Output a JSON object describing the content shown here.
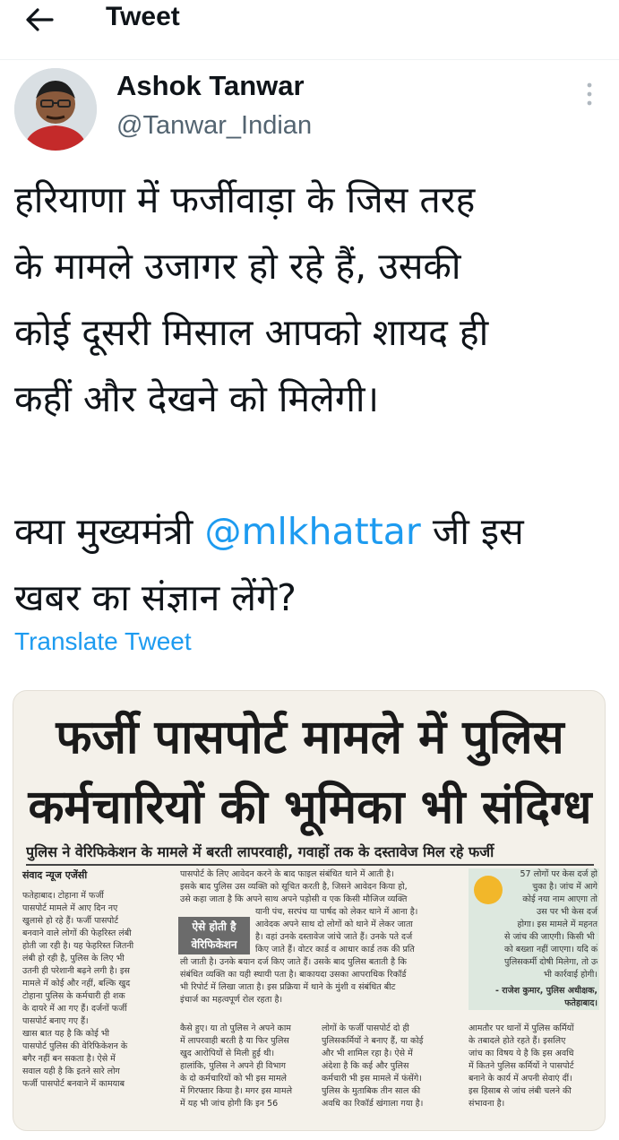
{
  "header": {
    "title": "Tweet"
  },
  "author": {
    "name": "Ashok Tanwar",
    "handle": "@Tanwar_Indian"
  },
  "tweet": {
    "lines": [
      "हरियाणा में फर्जीवाड़ा के जिस तरह",
      "के मामले उजागर हो रहे हैं, उसकी",
      "कोई दूसरी मिसाल आपको शायद ही",
      "कहीं और देखने को मिलेगी।"
    ],
    "line5_prefix": "क्या मुख्यमंत्री ",
    "mention": "@mlkhattar",
    "line5_suffix": " जी इस",
    "line6": "खबर का संज्ञान लेंगे?",
    "translate_label": "Translate Tweet"
  },
  "news_clipping": {
    "headline_line1": "फर्जी पासपोर्ट मामले में पुलिस",
    "headline_line2": "कर्मचारियों की भूमिका भी संदिग्ध",
    "subheadline": "पुलिस ने वेरिफिकेशन के मामले में बरती लापरवाही, गवाहों तक के दस्तावेज मिल रहे फर्जी",
    "source": "संवाद न्यूज एजेंसी",
    "box_line1": "ऐसे होती है",
    "box_line2": "वेरिफिकेशन",
    "quote_attribution": "- राजेश कुमार, पुलिस अधीक्षक, फतेहाबाद।",
    "col1": [
      "फतेहाबाद। टोहाना में फर्जी",
      "पासपोर्ट मामले में आए दिन नए",
      "खुलासे हो रहे हैं। फर्जी पासपोर्ट",
      "बनवाने वाले लोगों की फेहरिस्त लंबी",
      "होती जा रही है। यह फेहरिस्त जितनी",
      "लंबी हो रही है, पुलिस के लिए भी",
      "उतनी ही परेशानी बढ़ने लगी है। इस",
      "मामले में कोई और नहीं, बल्कि खुद",
      "टोहाना पुलिस के कर्मचारी ही शक",
      "के दायरे में आ गए हैं। दर्जनों फर्जी",
      "पासपोर्ट बनाए गए हैं।",
      "खास बात यह है कि कोई भी",
      "पासपोर्ट पुलिस की वेरिफिकेशन के",
      "बगैर नहीं बन सकता है। ऐसे में",
      "सवाल यही है कि इतने सारे लोग",
      "फर्जी पासपोर्ट बनवाने में कामयाब"
    ],
    "col2": [
      "पासपोर्ट के लिए आवेदन करने के बाद फाइल संबंधित थाने में आती है।",
      "इसके बाद पुलिस उस व्यक्ति को सूचित करती है, जिसने आवेदन किया हो,",
      "उसे कहा जाता है कि अपने साथ अपने पड़ोसी व एक किसी मौजिज व्यक्ति",
      "यानी पंच, सरपंच या पार्षद को लेकर थाने में आना है।",
      "आवेदक अपने साथ दो लोगों को थाने में लेकर जाता",
      "है। वहां उनके दस्तावेज जांचे जाते हैं। उनके पते दर्ज",
      "किए जाते हैं। वोटर कार्ड व आधार कार्ड तक की प्रति",
      "ली जाती है। उनके बयान दर्ज किए जाते हैं। उसके बाद पुलिस बताती है कि",
      "संबंधित व्यक्ति का यही स्थायी पता है। बाकायदा उसका आपराधिक रिकॉर्ड",
      "भी रिपोर्ट में लिखा जाता है। इस प्रक्रिया में थाने के मुंशी व संबंधित बीट",
      "इंचार्ज का महत्वपूर्ण रोल रहता है।",
      "कैसे हुए। या तो पुलिस ने अपने काम",
      "में लापरवाही बरती है या फिर पुलिस",
      "खुद आरोपियों से मिली हुई थी।",
      "हालांकि, पुलिस ने अपने ही विभाग",
      "के दो कर्मचारियों को भी इस मामले",
      "में गिरफ्तार किया है। मगर इस मामले",
      "में यह भी जांच होगी कि इन 56"
    ],
    "col3": [
      "लोगों के फर्जी पासपोर्ट दो ही",
      "पुलिसकर्मियों ने बनाए हैं, या कोई",
      "और भी शामिल रहा है। ऐसे में",
      "अंदेशा है कि कई और पुलिस",
      "कर्मचारी भी इस मामले में फंसेंगे।",
      "पुलिस के मुताबिक तीन साल की",
      "अवधि का रिकॉर्ड खंगाला गया है।"
    ],
    "quote": [
      "57 लोगों पर केस दर्ज हो",
      "चुका है। जांच में आगे",
      "कोई नया नाम आएगा तो",
      "उस पर भी केस दर्ज",
      "होगा। इस मामले में महनत",
      "से जांच की जाएगी। किसी भी दोषी",
      "को बख्शा नहीं जाएगा। यदि कोई",
      "पुलिसकर्मी दोषी मिलेगा, तो उस पर",
      "भी कार्रवाई होगी।"
    ],
    "col4": [
      "आमतौर पर थानों में पुलिस कर्मियों",
      "के तबादले होते रहते हैं। इसलिए",
      "जांच का विषय ये है कि इस अवधि",
      "में कितने पुलिस कर्मियों ने पासपोर्ट",
      "बनाने के कार्य में अपनी सेवाएं दीं।",
      "इस हिसाब से जांच लंबी चलने की",
      "संभावना है।"
    ]
  },
  "colors": {
    "link_blue": "#1d9bf0",
    "text_primary": "#0f1419",
    "text_secondary": "#536471"
  }
}
